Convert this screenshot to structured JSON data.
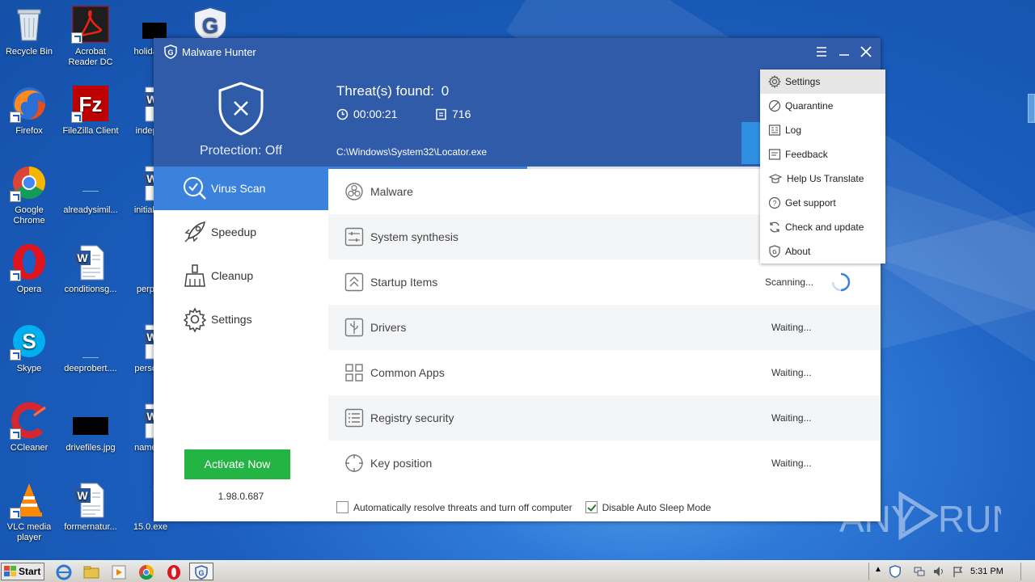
{
  "desktop": {
    "icons": [
      {
        "label": "Recycle Bin",
        "icon": "recycle-bin-icon"
      },
      {
        "label": "Acrobat Reader DC",
        "icon": "acrobat-icon"
      },
      {
        "label": "holidayb",
        "icon": "image-file-icon"
      },
      {
        "label": "",
        "icon": "malware-hunter-shield-icon"
      },
      {
        "label": "Firefox",
        "icon": "firefox-icon"
      },
      {
        "label": "FileZilla Client",
        "icon": "filezilla-icon"
      },
      {
        "label": "indeper",
        "icon": "word-doc-icon"
      },
      {
        "label": "Google Chrome",
        "icon": "chrome-icon"
      },
      {
        "label": "alreadysimil...",
        "icon": "blank-file-icon"
      },
      {
        "label": "initialmo",
        "icon": "word-doc-icon"
      },
      {
        "label": "Opera",
        "icon": "opera-icon"
      },
      {
        "label": "conditionsg...",
        "icon": "word-doc-icon"
      },
      {
        "label": "perpalr",
        "icon": "blank-file-icon"
      },
      {
        "label": "Skype",
        "icon": "skype-icon"
      },
      {
        "label": "deeprobert....",
        "icon": "blank-file-icon"
      },
      {
        "label": "persons",
        "icon": "word-doc-icon"
      },
      {
        "label": "CCleaner",
        "icon": "ccleaner-icon"
      },
      {
        "label": "drivefiles.jpg",
        "icon": "image-file-icon"
      },
      {
        "label": "namene",
        "icon": "word-doc-icon"
      },
      {
        "label": "VLC media player",
        "icon": "vlc-icon"
      },
      {
        "label": "formernatur...",
        "icon": "word-doc-icon"
      },
      {
        "label": "15.0.exe",
        "icon": "exe-icon"
      }
    ]
  },
  "window": {
    "title": "Malware Hunter",
    "protection": "Protection: Off",
    "threats_label": "Threat(s) found:",
    "threats_count": "0",
    "elapsed": "00:00:21",
    "items_scanned": "716",
    "current_path": "C:\\Windows\\System32\\Locator.exe",
    "progress_pct": 36
  },
  "sidebar": {
    "items": [
      {
        "label": "Virus Scan",
        "icon": "virus-scan-icon",
        "active": true
      },
      {
        "label": "Speedup",
        "icon": "rocket-icon",
        "active": false
      },
      {
        "label": "Cleanup",
        "icon": "broom-icon",
        "active": false
      },
      {
        "label": "Settings",
        "icon": "gear-icon",
        "active": false
      }
    ],
    "activate_label": "Activate Now",
    "version": "1.98.0.687"
  },
  "scan_items": [
    {
      "label": "Malware",
      "status": "",
      "icon": "biohazard-icon"
    },
    {
      "label": "System synthesis",
      "status": "",
      "icon": "sliders-icon"
    },
    {
      "label": "Startup Items",
      "status": "Scanning...",
      "icon": "startup-icon"
    },
    {
      "label": "Drivers",
      "status": "Waiting...",
      "icon": "usb-icon"
    },
    {
      "label": "Common Apps",
      "status": "Waiting...",
      "icon": "apps-grid-icon"
    },
    {
      "label": "Registry security",
      "status": "Waiting...",
      "icon": "registry-list-icon"
    },
    {
      "label": "Key position",
      "status": "Waiting...",
      "icon": "crosshair-icon"
    }
  ],
  "options": {
    "auto_resolve": {
      "label": "Automatically resolve threats and turn off computer",
      "checked": false
    },
    "disable_sleep": {
      "label": "Disable Auto Sleep Mode",
      "checked": true
    }
  },
  "menu": {
    "items": [
      {
        "label": "Settings",
        "icon": "gear-icon",
        "highlighted": true
      },
      {
        "label": "Quarantine",
        "icon": "quarantine-icon",
        "highlighted": false
      },
      {
        "label": "Log",
        "icon": "log-icon",
        "highlighted": false
      },
      {
        "label": "Feedback",
        "icon": "feedback-icon",
        "highlighted": false
      },
      {
        "label": "Help Us Translate",
        "icon": "graduation-cap-icon",
        "highlighted": false
      },
      {
        "label": "Get support",
        "icon": "question-icon",
        "highlighted": false
      },
      {
        "label": "Check and update",
        "icon": "refresh-icon",
        "highlighted": false
      },
      {
        "label": "About",
        "icon": "shield-small-icon",
        "highlighted": false
      }
    ]
  },
  "taskbar": {
    "start_label": "Start",
    "clock": "5:31 PM"
  },
  "watermark": {
    "text_left": "ANY",
    "text_right": "RUN"
  },
  "colors": {
    "accent_blue": "#2f5ba8",
    "active_blue": "#3a82dc",
    "activate_green": "#24b444"
  }
}
